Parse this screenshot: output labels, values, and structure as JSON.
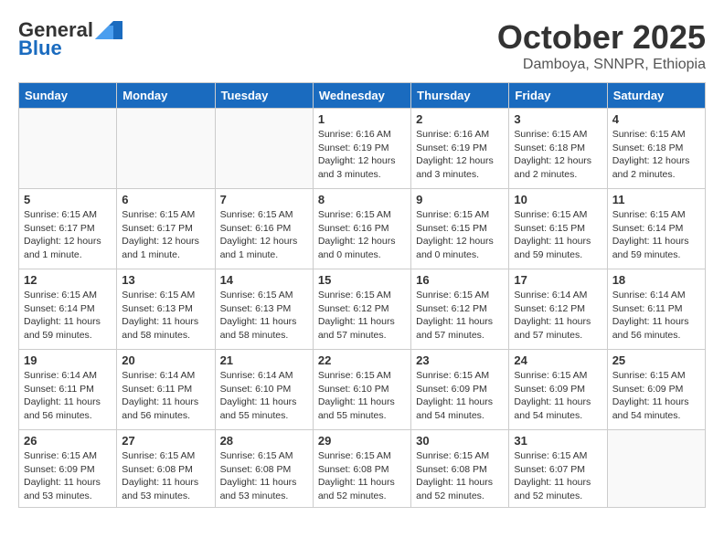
{
  "header": {
    "logo_general": "General",
    "logo_blue": "Blue",
    "month": "October 2025",
    "location": "Damboya, SNNPR, Ethiopia"
  },
  "weekdays": [
    "Sunday",
    "Monday",
    "Tuesday",
    "Wednesday",
    "Thursday",
    "Friday",
    "Saturday"
  ],
  "weeks": [
    [
      {
        "day": "",
        "info": ""
      },
      {
        "day": "",
        "info": ""
      },
      {
        "day": "",
        "info": ""
      },
      {
        "day": "1",
        "info": "Sunrise: 6:16 AM\nSunset: 6:19 PM\nDaylight: 12 hours and 3 minutes."
      },
      {
        "day": "2",
        "info": "Sunrise: 6:16 AM\nSunset: 6:19 PM\nDaylight: 12 hours and 3 minutes."
      },
      {
        "day": "3",
        "info": "Sunrise: 6:15 AM\nSunset: 6:18 PM\nDaylight: 12 hours and 2 minutes."
      },
      {
        "day": "4",
        "info": "Sunrise: 6:15 AM\nSunset: 6:18 PM\nDaylight: 12 hours and 2 minutes."
      }
    ],
    [
      {
        "day": "5",
        "info": "Sunrise: 6:15 AM\nSunset: 6:17 PM\nDaylight: 12 hours and 1 minute."
      },
      {
        "day": "6",
        "info": "Sunrise: 6:15 AM\nSunset: 6:17 PM\nDaylight: 12 hours and 1 minute."
      },
      {
        "day": "7",
        "info": "Sunrise: 6:15 AM\nSunset: 6:16 PM\nDaylight: 12 hours and 1 minute."
      },
      {
        "day": "8",
        "info": "Sunrise: 6:15 AM\nSunset: 6:16 PM\nDaylight: 12 hours and 0 minutes."
      },
      {
        "day": "9",
        "info": "Sunrise: 6:15 AM\nSunset: 6:15 PM\nDaylight: 12 hours and 0 minutes."
      },
      {
        "day": "10",
        "info": "Sunrise: 6:15 AM\nSunset: 6:15 PM\nDaylight: 11 hours and 59 minutes."
      },
      {
        "day": "11",
        "info": "Sunrise: 6:15 AM\nSunset: 6:14 PM\nDaylight: 11 hours and 59 minutes."
      }
    ],
    [
      {
        "day": "12",
        "info": "Sunrise: 6:15 AM\nSunset: 6:14 PM\nDaylight: 11 hours and 59 minutes."
      },
      {
        "day": "13",
        "info": "Sunrise: 6:15 AM\nSunset: 6:13 PM\nDaylight: 11 hours and 58 minutes."
      },
      {
        "day": "14",
        "info": "Sunrise: 6:15 AM\nSunset: 6:13 PM\nDaylight: 11 hours and 58 minutes."
      },
      {
        "day": "15",
        "info": "Sunrise: 6:15 AM\nSunset: 6:12 PM\nDaylight: 11 hours and 57 minutes."
      },
      {
        "day": "16",
        "info": "Sunrise: 6:15 AM\nSunset: 6:12 PM\nDaylight: 11 hours and 57 minutes."
      },
      {
        "day": "17",
        "info": "Sunrise: 6:14 AM\nSunset: 6:12 PM\nDaylight: 11 hours and 57 minutes."
      },
      {
        "day": "18",
        "info": "Sunrise: 6:14 AM\nSunset: 6:11 PM\nDaylight: 11 hours and 56 minutes."
      }
    ],
    [
      {
        "day": "19",
        "info": "Sunrise: 6:14 AM\nSunset: 6:11 PM\nDaylight: 11 hours and 56 minutes."
      },
      {
        "day": "20",
        "info": "Sunrise: 6:14 AM\nSunset: 6:11 PM\nDaylight: 11 hours and 56 minutes."
      },
      {
        "day": "21",
        "info": "Sunrise: 6:14 AM\nSunset: 6:10 PM\nDaylight: 11 hours and 55 minutes."
      },
      {
        "day": "22",
        "info": "Sunrise: 6:15 AM\nSunset: 6:10 PM\nDaylight: 11 hours and 55 minutes."
      },
      {
        "day": "23",
        "info": "Sunrise: 6:15 AM\nSunset: 6:09 PM\nDaylight: 11 hours and 54 minutes."
      },
      {
        "day": "24",
        "info": "Sunrise: 6:15 AM\nSunset: 6:09 PM\nDaylight: 11 hours and 54 minutes."
      },
      {
        "day": "25",
        "info": "Sunrise: 6:15 AM\nSunset: 6:09 PM\nDaylight: 11 hours and 54 minutes."
      }
    ],
    [
      {
        "day": "26",
        "info": "Sunrise: 6:15 AM\nSunset: 6:09 PM\nDaylight: 11 hours and 53 minutes."
      },
      {
        "day": "27",
        "info": "Sunrise: 6:15 AM\nSunset: 6:08 PM\nDaylight: 11 hours and 53 minutes."
      },
      {
        "day": "28",
        "info": "Sunrise: 6:15 AM\nSunset: 6:08 PM\nDaylight: 11 hours and 53 minutes."
      },
      {
        "day": "29",
        "info": "Sunrise: 6:15 AM\nSunset: 6:08 PM\nDaylight: 11 hours and 52 minutes."
      },
      {
        "day": "30",
        "info": "Sunrise: 6:15 AM\nSunset: 6:08 PM\nDaylight: 11 hours and 52 minutes."
      },
      {
        "day": "31",
        "info": "Sunrise: 6:15 AM\nSunset: 6:07 PM\nDaylight: 11 hours and 52 minutes."
      },
      {
        "day": "",
        "info": ""
      }
    ]
  ]
}
